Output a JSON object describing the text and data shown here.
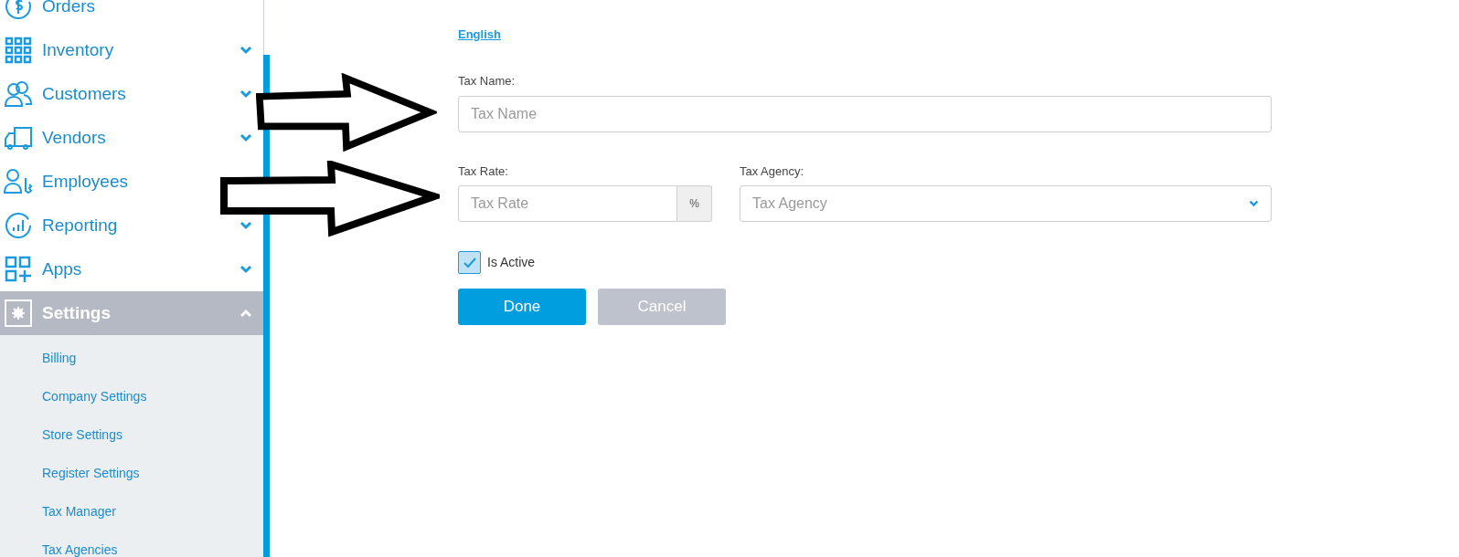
{
  "sidebar": {
    "items": [
      {
        "label": "Orders",
        "selected": false
      },
      {
        "label": "Inventory",
        "selected": false,
        "expanded": false
      },
      {
        "label": "Customers",
        "selected": false,
        "expanded": false
      },
      {
        "label": "Vendors",
        "selected": false,
        "expanded": false
      },
      {
        "label": "Employees",
        "selected": false
      },
      {
        "label": "Reporting",
        "selected": false,
        "expanded": false
      },
      {
        "label": "Apps",
        "selected": false,
        "expanded": false
      },
      {
        "label": "Settings",
        "selected": true,
        "expanded": true,
        "children": [
          {
            "label": "Billing"
          },
          {
            "label": "Company Settings"
          },
          {
            "label": "Store Settings"
          },
          {
            "label": "Register Settings"
          },
          {
            "label": "Tax Manager"
          },
          {
            "label": "Tax Agencies"
          }
        ]
      }
    ]
  },
  "form": {
    "language_link": "English",
    "tax_name": {
      "label": "Tax Name:",
      "placeholder": "Tax Name"
    },
    "tax_rate": {
      "label": "Tax Rate:",
      "placeholder": "Tax Rate",
      "unit": "%"
    },
    "tax_agency": {
      "label": "Tax Agency:",
      "placeholder": "Tax Agency"
    },
    "is_active": {
      "label": "Is Active",
      "checked": true
    },
    "buttons": [
      {
        "label": "Done",
        "kind": "primary"
      },
      {
        "label": "Cancel",
        "kind": "secondary"
      }
    ]
  }
}
